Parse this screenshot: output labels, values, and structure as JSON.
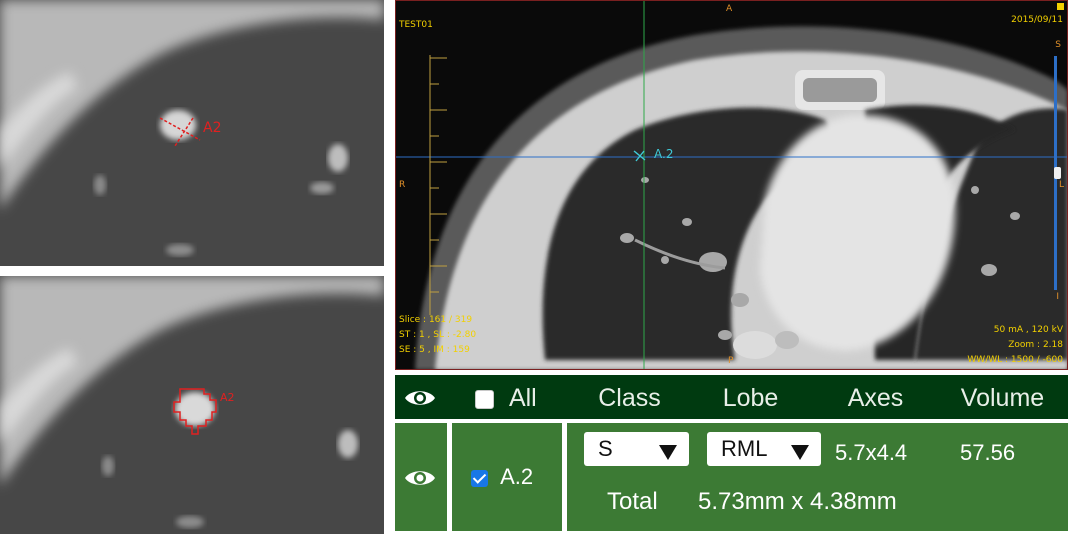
{
  "viewer": {
    "patient_id": "TEST01",
    "date": "2015/09/11",
    "orient_top": "A",
    "orient_bottom": "P",
    "orient_left": "R",
    "orient_right": "L",
    "scroll_top_label": "S",
    "scroll_bottom_label": "I",
    "nodule_label": "A.2",
    "slice_info": "Slice : 161 / 319",
    "st_sl": "ST : 1 , SL : -2.80",
    "se_im": "SE : 5 , IM : 159",
    "ma_kv": "50 mA , 120 kV",
    "zoom": "Zoom : 2.18",
    "window": "WW/WL : 1500 / -600",
    "slice_position_fraction": 0.5
  },
  "thumbnails": {
    "top_label": "A2",
    "bottom_label": "A2"
  },
  "table": {
    "header": {
      "all_label": "All",
      "all_checked": false,
      "class_label": "Class",
      "lobe_label": "Lobe",
      "axes_label": "Axes",
      "volume_label": "Volume"
    },
    "rows": [
      {
        "name": "A.2",
        "checked": true,
        "class_value": "S",
        "lobe_value": "RML",
        "axes": "5.7x4.4",
        "volume": "57.56",
        "total_label": "Total",
        "total_value": "5.73mm x 4.38mm"
      }
    ]
  },
  "colors": {
    "header_bg": "#003a10",
    "row_bg": "#3c7a34",
    "overlay_text": "#f2d000",
    "marker_red": "#e02020",
    "marker_cyan": "#3fc9d6",
    "checkbox_blue": "#1877e6"
  },
  "icons": [
    "eye-icon",
    "checkbox-icon",
    "dropdown-arrow-icon",
    "nodule-marker-icon"
  ]
}
